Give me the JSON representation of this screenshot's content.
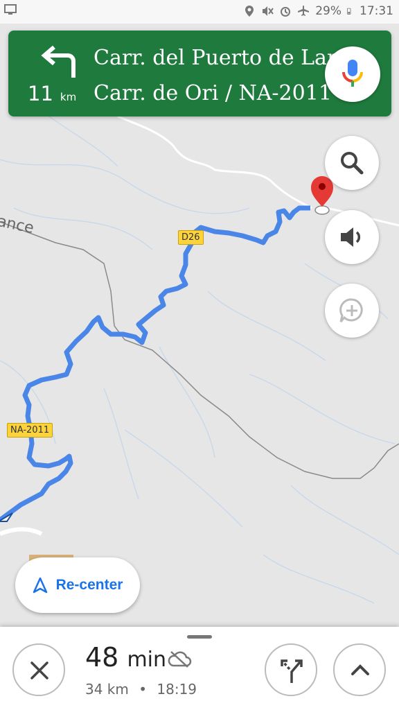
{
  "status_bar": {
    "battery_percent": "29%",
    "time": "17:31",
    "icons": [
      "screen-icon",
      "location-icon",
      "mute-icon",
      "alarm-icon",
      "airplane-icon",
      "battery-icon"
    ]
  },
  "navigation": {
    "maneuver_icon": "turn-left-icon",
    "distance_value": "11",
    "distance_unit": "km",
    "primary_street": "Carr. del Puerto de Larrau",
    "secondary_street": "Carr. de Ori / NA-2011",
    "header_color": "#1f7a3d"
  },
  "map": {
    "road_labels": [
      "D26",
      "NA-2011"
    ],
    "place_fragment": "ance",
    "route_color": "#4a86e8",
    "destination_marker_color": "#e53935"
  },
  "controls": {
    "recenter_label": "Re-center",
    "search_icon": "search-icon",
    "sound_icon": "sound-icon",
    "report_icon": "add-report-icon"
  },
  "eta": {
    "duration_value": "48",
    "duration_unit": "min",
    "distance": "34 km",
    "separator": "•",
    "arrival_time": "18:19"
  }
}
